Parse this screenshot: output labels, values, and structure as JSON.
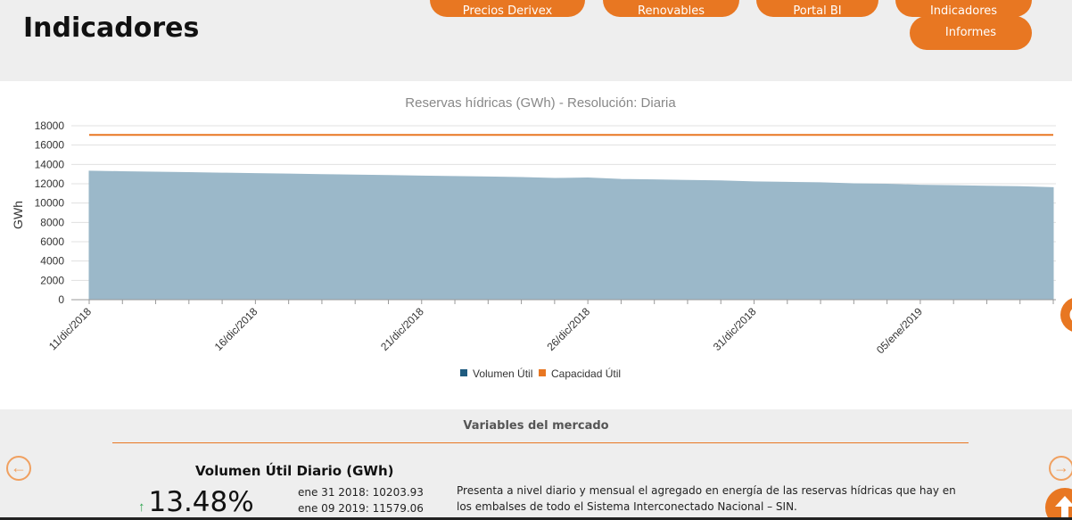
{
  "header": {
    "title": "Indicadores",
    "nav": {
      "derivex": "Precios Derivex",
      "renovables": "Renovables",
      "portal_bi": "Portal BI",
      "indicadores": "Indicadores",
      "informes": "Informes"
    }
  },
  "chart_data": {
    "type": "area",
    "title": "Reservas hídricas (GWh) - Resolución: Diaria",
    "xlabel": "",
    "ylabel": "GWh",
    "ylim": [
      0,
      18000
    ],
    "yticks": [
      "0",
      "2000",
      "4000",
      "6000",
      "8000",
      "10000",
      "12000",
      "14000",
      "16000",
      "18000"
    ],
    "xticks": [
      "11/dic/2018",
      "16/dic/2018",
      "21/dic/2018",
      "26/dic/2018",
      "31/dic/2018",
      "05/ene/2019"
    ],
    "x": [
      "11/dic/2018",
      "12/dic/2018",
      "13/dic/2018",
      "14/dic/2018",
      "15/dic/2018",
      "16/dic/2018",
      "17/dic/2018",
      "18/dic/2018",
      "19/dic/2018",
      "20/dic/2018",
      "21/dic/2018",
      "22/dic/2018",
      "23/dic/2018",
      "24/dic/2018",
      "25/dic/2018",
      "26/dic/2018",
      "27/dic/2018",
      "28/dic/2018",
      "29/dic/2018",
      "30/dic/2018",
      "31/dic/2018",
      "01/ene/2019",
      "02/ene/2019",
      "03/ene/2019",
      "04/ene/2019",
      "05/ene/2019",
      "06/ene/2019",
      "07/ene/2019",
      "08/ene/2019",
      "09/ene/2019"
    ],
    "series": [
      {
        "name": "Volumen Útil",
        "color": "#9bb8c9",
        "legend_color": "#1f5b7f",
        "values": [
          13300,
          13250,
          13200,
          13150,
          13100,
          13050,
          13000,
          12950,
          12900,
          12850,
          12800,
          12750,
          12700,
          12650,
          12550,
          12600,
          12450,
          12400,
          12350,
          12300,
          12200,
          12150,
          12100,
          12000,
          11950,
          11850,
          11800,
          11750,
          11700,
          11600
        ]
      },
      {
        "name": "Capacidad Útil",
        "color": "#e87722",
        "legend_color": "#e87722",
        "values": [
          17050,
          17050,
          17050,
          17050,
          17050,
          17050,
          17050,
          17050,
          17050,
          17050,
          17050,
          17050,
          17050,
          17050,
          17050,
          17050,
          17050,
          17050,
          17050,
          17050,
          17050,
          17050,
          17050,
          17050,
          17050,
          17050,
          17050,
          17050,
          17050,
          17050
        ]
      }
    ],
    "grid": true,
    "legend_position": "bottom-center"
  },
  "market": {
    "title": "Variables del mercado",
    "indicator_title": "Volumen Útil Diario (GWh)",
    "change": "13.48%",
    "comparison_1": "ene 31 2018: 10203.93",
    "comparison_2": "ene 09 2019: 11579.06",
    "description": "Presenta a nivel diario y mensual el agregado en energía de las reservas hídricas que hay en los embalses de todo el Sistema Interconectado Nacional – SIN."
  },
  "colors": {
    "accent": "#e87722",
    "header_bg": "#eeeeee"
  }
}
